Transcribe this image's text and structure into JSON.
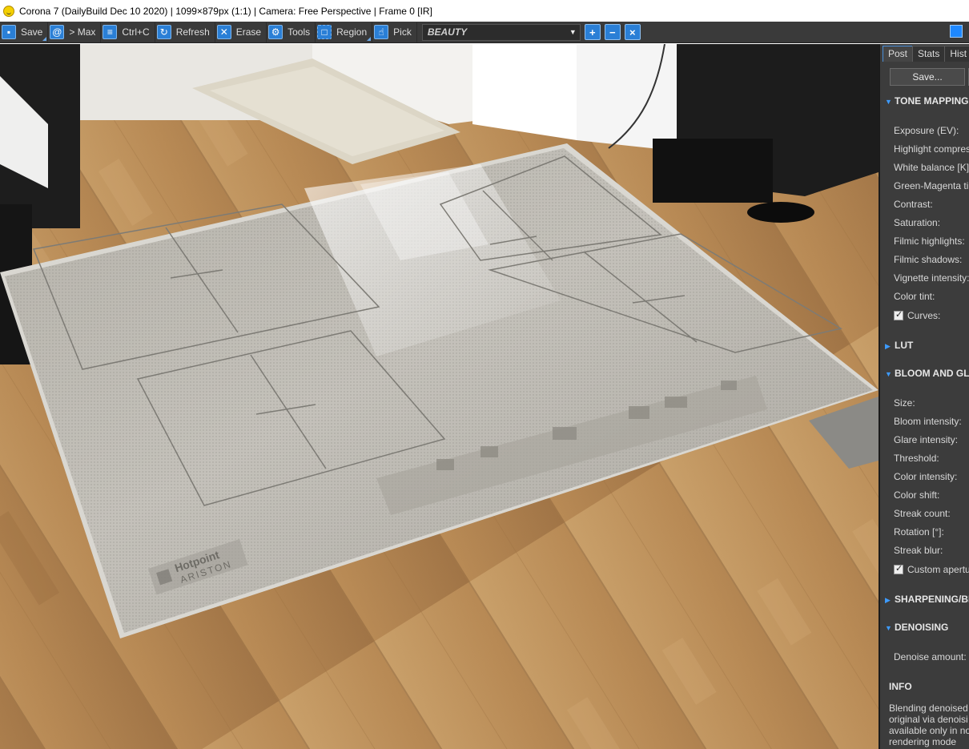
{
  "window": {
    "title": "Corona 7 (DailyBuild Dec 10 2020) | 1099×879px (1:1) | Camera: Free Perspective | Frame 0 [IR]"
  },
  "toolbar": {
    "save": "Save",
    "max": "> Max",
    "copy": "Ctrl+C",
    "refresh": "Refresh",
    "erase": "Erase",
    "tools": "Tools",
    "region": "Region",
    "pick": "Pick",
    "render_element": "BEAUTY"
  },
  "icons": {
    "save": "floppy-icon",
    "max": "spiral-icon",
    "copy": "document-icon",
    "refresh": "refresh-icon",
    "erase": "x-icon",
    "tools": "gear-icon",
    "region": "dashed-square-icon",
    "pick": "hand-pointer-icon",
    "zoom_in": "zoom-in-icon",
    "zoom_out": "zoom-out-icon",
    "zoom_fit": "zoom-fit-icon"
  },
  "viewport": {
    "brand_line1": "Hotpoint",
    "brand_line2": "ARISTON"
  },
  "panel": {
    "tabs": [
      "Post",
      "Stats",
      "Hist"
    ],
    "save_button": "Save...",
    "sections": {
      "tone_mapping": "TONE MAPPING",
      "lut": "LUT",
      "bloom": "BLOOM AND GLA",
      "sharpening": "SHARPENING/BL",
      "denoising": "DENOISING",
      "info": "INFO"
    },
    "tone_rows": [
      "Exposure (EV):",
      "Highlight compres",
      "White balance [K]:",
      "Green-Magenta tin",
      "Contrast:",
      "Saturation:",
      "Filmic highlights:",
      "Filmic shadows:",
      "Vignette intensity:",
      "Color tint:"
    ],
    "curves": "Curves:",
    "bloom_rows": [
      "Size:",
      "Bloom intensity:",
      "Glare intensity:",
      "Threshold:",
      "Color intensity:",
      "Color shift:",
      "Streak count:",
      "Rotation [°]:",
      "Streak blur:"
    ],
    "custom_aperture": "Custom apertu",
    "denoise_amount": "Denoise amount:",
    "info_lines": [
      "Blending denoised",
      "original via denoisi",
      "available only in no",
      "rendering mode"
    ]
  }
}
